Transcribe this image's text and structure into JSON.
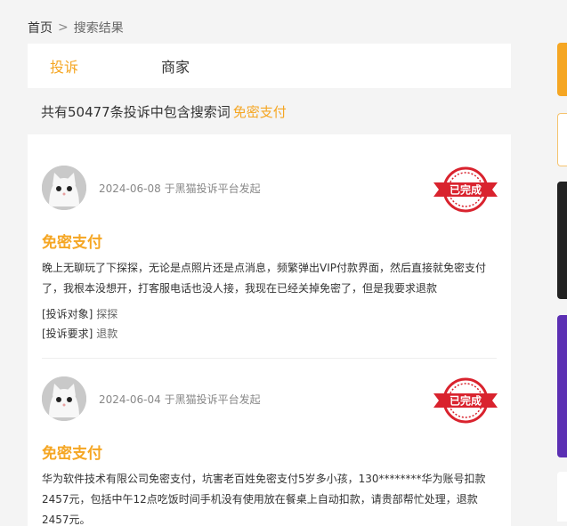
{
  "breadcrumb": {
    "home": "首页",
    "separator": ">",
    "current": "搜索结果"
  },
  "tabs": [
    {
      "label": "投诉",
      "active": true
    },
    {
      "label": "商家",
      "active": false
    }
  ],
  "summary": {
    "text": "共有50477条投诉中包含搜索词",
    "keyword": "免密支付"
  },
  "complaints": [
    {
      "date": "2024-06-08",
      "source": "于黑猫投诉平台发起",
      "status": "已完成",
      "title": "免密支付",
      "content": "晚上无聊玩了下探探，无论是点照片还是点消息，频繁弹出VIP付款界面，然后直接就免密支付了，我根本没想开，打客服电话也没人接，我现在已经关掉免密了，但是我要求退款",
      "target_label": "[投诉对象]",
      "target_value": "探探",
      "demand_label": "[投诉要求]",
      "demand_value": "退款"
    },
    {
      "date": "2024-06-04",
      "source": "于黑猫投诉平台发起",
      "status": "已完成",
      "title": "免密支付",
      "content": "华为软件技术有限公司免密支付，坑害老百姓免密支付5岁多小孩，130********华为账号扣款2457元，包括中午12点吃饭时间手机没有使用放在餐桌上自动扣款，请贵部帮忙处理，退款2457元。"
    }
  ],
  "colors": {
    "accent": "#f5a623",
    "stamp": "#d9232e"
  },
  "icons": {
    "avatar": "cat-avatar-icon",
    "stamp": "completed-stamp-icon"
  }
}
